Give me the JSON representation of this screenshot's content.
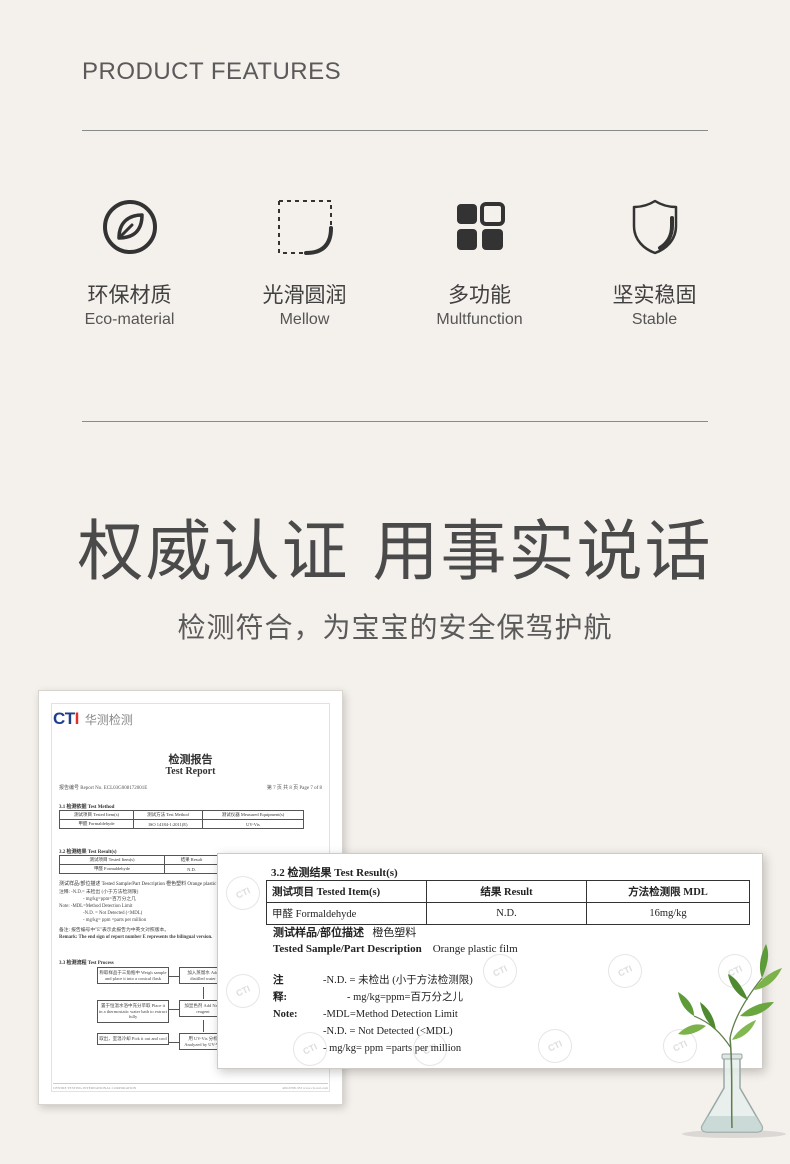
{
  "section_title": "PRODUCT FEATURES",
  "features": [
    {
      "icon": "leaf-icon",
      "zh": "环保材质",
      "en": "Eco-material"
    },
    {
      "icon": "rounded-corner-icon",
      "zh": "光滑圆润",
      "en": "Mellow"
    },
    {
      "icon": "grid-icon",
      "zh": "多功能",
      "en": "Multfunction"
    },
    {
      "icon": "shield-icon",
      "zh": "坚实稳固",
      "en": "Stable"
    }
  ],
  "headline": "权威认证 用事实说话",
  "subline": "检测符合，为宝宝的安全保驾护航",
  "report_small": {
    "logo_cti": "CTI",
    "logo_cn": "华测检测",
    "title_zh": "检测报告",
    "title_en": "Test Report",
    "report_no_label": "报告编号 Report No.",
    "report_no": "ECL03G008172001E",
    "page_label": "第 7 页 共 8 页 Page 7 of 8",
    "section_method": "3.1 检测依据 Test Method",
    "method_head": [
      "测试项目 Tested Item(s)",
      "测试方法 Test Method",
      "测试仪器 Measured Equipment(s)"
    ],
    "method_row": [
      "甲醛 Formaldehyde",
      "ISO 14184-1:2011(E)",
      "UV-Vis"
    ],
    "section_result": "3.2 检测结果 Test Result(s)",
    "result_head": [
      "测试项目 Tested Item(s)",
      "结果 Result"
    ],
    "result_row": [
      "甲醛 Formaldehyde",
      "N.D."
    ],
    "sample_line": "测试样品/部位描述 Tested Sample/Part Description  橙色塑料 Orange plastic film",
    "notes": [
      "注释:  -N.D.= 未检出 (小于方法检测限)",
      "- mg/kg=ppm=百万分之几",
      "Note:  -MDL=Method Detection Limit",
      "-N.D. = Not Detected (<MDL)",
      "- mg/kg= ppm =parts per million",
      "备注:  报告编号中\"E\"表示此报告为中英文对照版本。",
      "Remark: The end sign of report number E represents the bilingual version."
    ],
    "section_process": "3.3 检测流程 Test Process",
    "flow": [
      "称取样品于三角瓶中 Weigh sample and place it into a conical flask",
      "加入蒸馏水 Add distilled water",
      "置于恒温水浴中充分萃取 Place it in a thermostatic water bath to extract fully",
      "加显色剂 Add Nash reagent",
      "取出，室温冷却 Pick it out and cool",
      "用 UV-Vis 分析 Analyzed by UV-Vis"
    ],
    "footer_left": "CENTRE TESTING INTERNATIONAL CORPORATION",
    "footer_right": "400-6788-333  www.cti-cert.com"
  },
  "report_large": {
    "heading": "3.2 检测结果 Test Result(s)",
    "table_head": [
      "测试项目 Tested Item(s)",
      "结果 Result",
      "方法检测限 MDL"
    ],
    "table_row": [
      "甲醛 Formaldehyde",
      "N.D.",
      "16mg/kg"
    ],
    "sample_label_zh": "测试样品/部位描述",
    "sample_value_zh": "橙色塑料",
    "sample_label_en": "Tested Sample/Part Description",
    "sample_value_en": "Orange plastic film",
    "notes_label_zh": "注释:",
    "notes_label_en": "Note:",
    "notes": [
      "-N.D. =  未检出 (小于方法检测限)",
      "- mg/kg=ppm=百万分之儿",
      "-MDL=Method Detection Limit",
      "-N.D. = Not Detected (<MDL)",
      "- mg/kg= ppm =parts per million"
    ],
    "watermark": "CTI"
  }
}
